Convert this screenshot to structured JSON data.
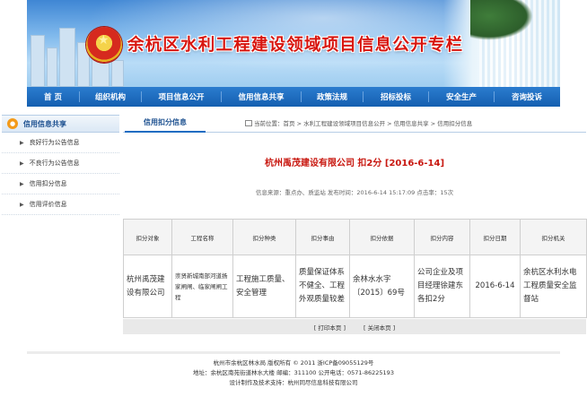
{
  "banner": {
    "title": "余杭区水利工程建设领域项目信息公开专栏"
  },
  "nav": {
    "items": [
      "首 页",
      "组织机构",
      "项目信息公开",
      "信用信息共享",
      "政策法规",
      "招标投标",
      "安全生产",
      "咨询投诉"
    ]
  },
  "sidebar": {
    "heading": "信用信息共享",
    "items": [
      "良好行为公告信息",
      "不良行为公告信息",
      "信用扣分信息",
      "信用评价信息"
    ]
  },
  "content": {
    "tab": "信用扣分信息",
    "breadcrumb": "当前位置：首页 > 水利工程建设领域项目信息公开 > 信用信息共享 > 信用扣分信息",
    "article_title": "杭州禹茂建设有限公司  扣2分 [2016-6-14]",
    "meta": "信息来源：重点办、质监站  发布时间：2016-6-14 15:17:09  点击率：15次"
  },
  "table": {
    "headers": [
      "扣分对象",
      "工程名称",
      "扣分种类",
      "扣分事由",
      "扣分依据",
      "扣分内容",
      "扣分日期",
      "扣分机关"
    ],
    "row": [
      "杭州禹茂建设有限公司",
      "崇贤新城南部河道扬家闸闸、临家闸闸工程",
      "工程施工质量、安全管理",
      "质量保证体系不健全、工程外观质量较差",
      "余林水水字〔2015〕69号",
      "公司企业及项目经理徐建东各扣2分",
      "2016-6-14",
      "余杭区水利水电工程质量安全监督站"
    ]
  },
  "actions": {
    "print": "[ 打印本页 ]",
    "close": "[ 关闭本页 ]"
  },
  "footer": {
    "line1": "杭州市余杭区林水局  版权所有  © 2011   浙ICP备09055129号",
    "line2": "地址：余杭区南苑街道林水大楼   邮编：311100   公开电话：0571-86225193",
    "line3": "设计制作及技术支持：杭州同尽信息科技有限公司"
  },
  "colors": {
    "title_red": "#d8150e",
    "nav_blue": "#145fb0",
    "article_red": "#c8170f"
  }
}
